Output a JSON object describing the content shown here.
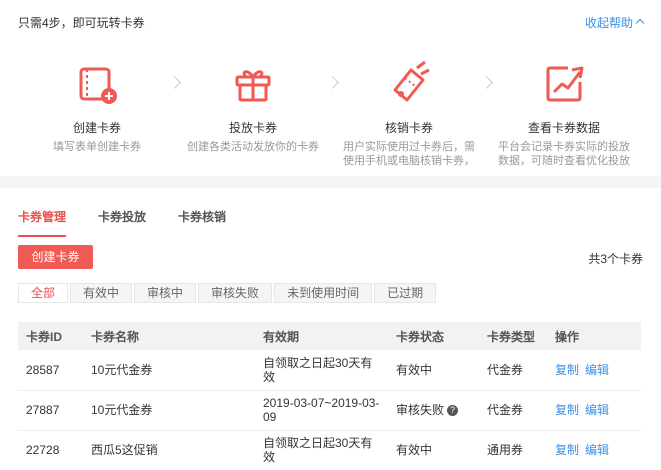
{
  "help": {
    "title": "只需4步，即可玩转卡券",
    "collapse_label": "收起帮助",
    "steps": [
      {
        "title": "创建卡券",
        "desc": "填写表单创建卡券",
        "icon": "card-add-icon"
      },
      {
        "title": "投放卡券",
        "desc": "创建各类活动发放你的卡券",
        "icon": "gift-icon"
      },
      {
        "title": "核销卡券",
        "desc": "用户实际使用过卡券后，需使用手机或电脑核销卡券，记录使用情况",
        "icon": "ticket-verify-icon"
      },
      {
        "title": "查看卡券数据",
        "desc": "平台会记录卡券实际的投放数据，可随时查看优化投放",
        "icon": "trend-chart-icon"
      }
    ]
  },
  "tabs": [
    "卡券管理",
    "卡券投放",
    "卡券核销"
  ],
  "toolbar": {
    "create_label": "创建卡券",
    "total_label": "共3个卡券"
  },
  "filters": [
    "全部",
    "有效中",
    "审核中",
    "审核失败",
    "未到使用时间",
    "已过期"
  ],
  "table": {
    "headers": [
      "卡券ID",
      "卡券名称",
      "有效期",
      "卡券状态",
      "卡券类型",
      "操作"
    ],
    "rows": [
      {
        "id": "28587",
        "name": "10元代金券",
        "validity": "自领取之日起30天有效",
        "status": "有效中",
        "type": "代金券",
        "copy": "复制",
        "edit": "编辑"
      },
      {
        "id": "27887",
        "name": "10元代金券",
        "validity": "2019-03-07~2019-03-09",
        "status": "审核失败",
        "type": "代金券",
        "copy": "复制",
        "edit": "编辑"
      },
      {
        "id": "22728",
        "name": "西瓜5这促销",
        "validity": "自领取之日起30天有效",
        "status": "有效中",
        "type": "通用券",
        "copy": "复制",
        "edit": "编辑"
      }
    ]
  },
  "colors": {
    "accent": "#f05a55",
    "link": "#3b8fe4"
  }
}
